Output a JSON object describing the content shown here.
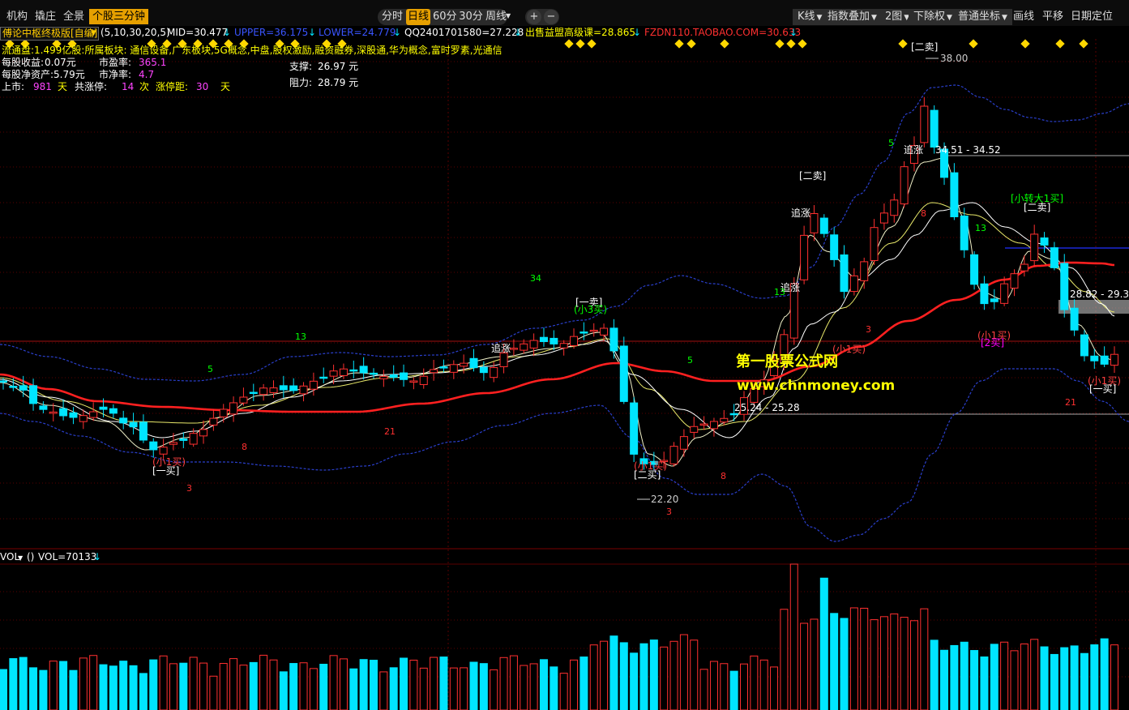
{
  "toolbar": {
    "left_tabs": [
      "机构",
      "撬庄",
      "全景"
    ],
    "active_tab": "个股三分钟",
    "periods": [
      "分时",
      "日线",
      "60分",
      "30分",
      "周线"
    ],
    "selected_period": "日线",
    "zoom_in": "+",
    "zoom_out": "−",
    "right_buttons": [
      "K线",
      "指数叠加",
      "2图",
      "下除权",
      "普通坐标"
    ],
    "right_links": [
      "画线",
      "平移",
      "日期定位"
    ]
  },
  "indicator_line": {
    "formula_name": "傅论中枢终极版[自编]",
    "params": "(5,10,30,20,5)",
    "mid": "MID=30.477",
    "upper": "UPPER=36.175",
    "lower": "LOWER=24.779",
    "qq": "QQ2401701580=27.228",
    "ad": "出售益盟高级课=28.865",
    "fzdn": "FZDN110.TAOBAO.COM=30.633"
  },
  "stock_info": {
    "line1": "流通盘:1.499亿股:所属板块: 通信设备,广东板块,5G概念,中盘,股权激励,融资融券,深股通,华为概念,富时罗素,光通信",
    "eps_label": "每股收益:",
    "eps": "0.07元",
    "pe_label": "市盈率:",
    "pe": "365.1",
    "navps_label": "每股净资产:",
    "navps": "5.79元",
    "pb_label": "市净率:",
    "pb": "4.7",
    "listed_label": "上市:",
    "listed_days": "981",
    "days_unit": "天",
    "limit_label": "共涨停:",
    "limit_count": "14",
    "times_unit": "次",
    "dist_label": "涨停距:",
    "dist_days": "30",
    "support_label": "支撑:",
    "support": "26.97 元",
    "resistance_label": "阻力:",
    "resistance": "28.79 元"
  },
  "chart_labels": [
    {
      "text": "[二卖]",
      "color": "#ffffff"
    },
    {
      "text": "38.00",
      "color": "#cccccc"
    },
    {
      "text": "34.51 - 34.52",
      "color": "#ffffff"
    },
    {
      "text": "追涨",
      "color": "#ffffff"
    },
    {
      "text": "[二卖]",
      "color": "#ffffff"
    },
    {
      "text": "追涨",
      "color": "#ffffff"
    },
    {
      "text": "追涨",
      "color": "#ffffff"
    },
    {
      "text": "[小转大1买]",
      "color": "#00ff00"
    },
    {
      "text": "[二卖]",
      "color": "#ffffff"
    },
    {
      "text": "28.82 - 29.35",
      "color": "#ffffff"
    },
    {
      "text": "[一卖]",
      "color": "#ffffff"
    },
    {
      "text": "(小3买)",
      "color": "#00ff00"
    },
    {
      "text": "追涨",
      "color": "#ffffff"
    },
    {
      "text": "(小1买)",
      "color": "#ff4040"
    },
    {
      "text": "[2买]",
      "color": "#ff00ff"
    },
    {
      "text": "(小1买)",
      "color": "#ff4040"
    },
    {
      "text": "(小1买)",
      "color": "#ff4040"
    },
    {
      "text": "[一买]",
      "color": "#ffffff"
    },
    {
      "text": "(小1买)",
      "color": "#ff4040"
    },
    {
      "text": "[一买]",
      "color": "#ffffff"
    },
    {
      "text": "(小1买)",
      "color": "#ff4040"
    },
    {
      "text": "[二买]",
      "color": "#ffffff"
    },
    {
      "text": "25.24 - 25.28",
      "color": "#ffffff"
    },
    {
      "text": "22.20",
      "color": "#cccccc"
    }
  ],
  "count_labels": [
    {
      "text": "34",
      "color": "#00ff00"
    },
    {
      "text": "13",
      "color": "#00ff00"
    },
    {
      "text": "5",
      "color": "#00ff00"
    },
    {
      "text": "8",
      "color": "#ff3030"
    },
    {
      "text": "21",
      "color": "#ff3030"
    },
    {
      "text": "3",
      "color": "#ff3030"
    },
    {
      "text": "5",
      "color": "#00ff00"
    },
    {
      "text": "8",
      "color": "#ff3030"
    },
    {
      "text": "3",
      "color": "#ff3030"
    },
    {
      "text": "13",
      "color": "#00ff00"
    },
    {
      "text": "3",
      "color": "#ff3030"
    },
    {
      "text": "5",
      "color": "#00ff00"
    },
    {
      "text": "8",
      "color": "#ff3030"
    },
    {
      "text": "13",
      "color": "#00ff00"
    },
    {
      "text": "21",
      "color": "#ff3030"
    }
  ],
  "watermark": {
    "site_name": "第一股票公式网",
    "url": "www.chnmoney.com"
  },
  "volume_panel": {
    "name": "VOL",
    "params": "()",
    "value": "VOL=70133"
  },
  "colors": {
    "up": "#ff3030",
    "down": "#00e5ff",
    "ma_main": "#ff2020",
    "band": "#2a3fcc",
    "accent": "#e6a000",
    "diamond": "#ffd700"
  }
}
